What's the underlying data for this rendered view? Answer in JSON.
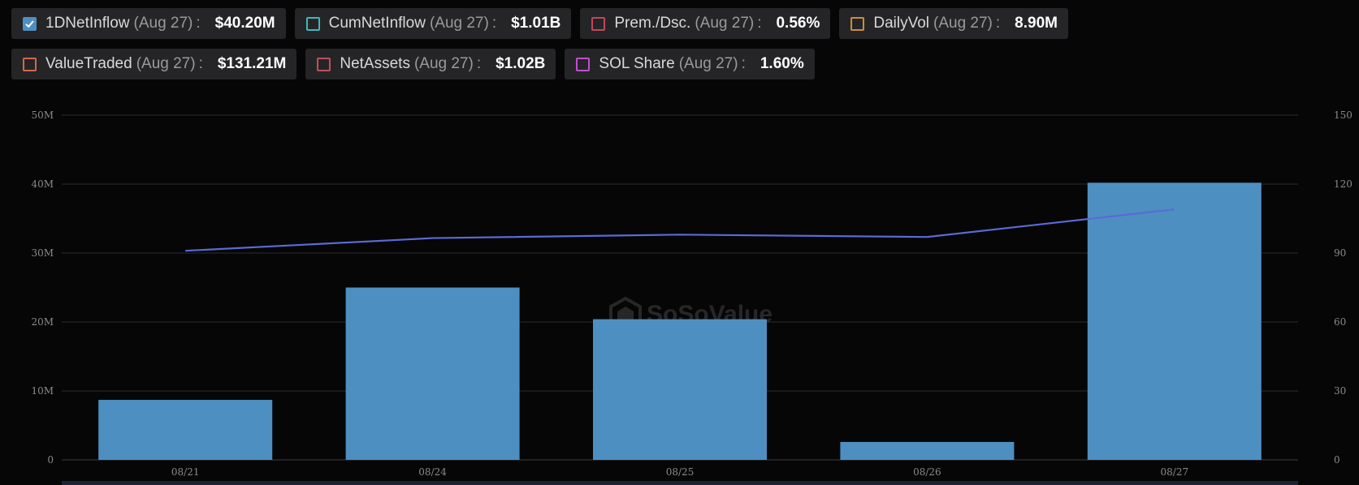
{
  "legend": [
    {
      "name": "1DNetInflow",
      "date": "(Aug 27)",
      "sep": ":",
      "value": "$40.20M",
      "color": "#4e8fc2",
      "checked": true
    },
    {
      "name": "CumNetInflow",
      "date": "(Aug 27)",
      "sep": ":",
      "value": "$1.01B",
      "color": "#3fb8be",
      "checked": false
    },
    {
      "name": "Prem./Dsc.",
      "date": "(Aug 27)",
      "sep": ":",
      "value": "0.56%",
      "color": "#c2475a",
      "checked": false
    },
    {
      "name": "DailyVol",
      "date": "(Aug 27)",
      "sep": ":",
      "value": "8.90M",
      "color": "#c98f3c",
      "checked": false
    },
    {
      "name": "ValueTraded",
      "date": "(Aug 27)",
      "sep": ":",
      "value": "$131.21M",
      "color": "#d0684a",
      "checked": false
    },
    {
      "name": "NetAssets",
      "date": "(Aug 27)",
      "sep": ":",
      "value": "$1.02B",
      "color": "#c0505c",
      "checked": false
    },
    {
      "name": "SOL Share",
      "date": "(Aug 27)",
      "sep": ":",
      "value": "1.60%",
      "color": "#c04fd0",
      "checked": false
    }
  ],
  "watermark": "SoSoValue",
  "chart_data": {
    "type": "bar",
    "categories": [
      "08/21",
      "08/24",
      "08/25",
      "08/26",
      "08/27"
    ],
    "series": [
      {
        "name": "1DNetInflow",
        "type": "bar",
        "axis": "left",
        "values": [
          8.7,
          25.0,
          20.4,
          2.6,
          40.2
        ],
        "color": "#4e8fc2"
      },
      {
        "type": "line",
        "axis": "right",
        "values": [
          91,
          96.5,
          98,
          97,
          109
        ],
        "color": "#5a6ad6"
      }
    ],
    "y_left": {
      "ylim": [
        0,
        50
      ],
      "ticks": [
        0,
        10,
        20,
        30,
        40,
        50
      ],
      "tick_labels": [
        "0",
        "10M",
        "20M",
        "30M",
        "40M",
        "50M"
      ]
    },
    "y_right": {
      "ylim": [
        0,
        150
      ],
      "ticks": [
        0,
        30,
        60,
        90,
        120,
        150
      ],
      "tick_labels": [
        "0",
        "30",
        "60",
        "90",
        "120",
        "150"
      ]
    },
    "grid": true,
    "title": "",
    "xlabel": "",
    "ylabel": ""
  }
}
